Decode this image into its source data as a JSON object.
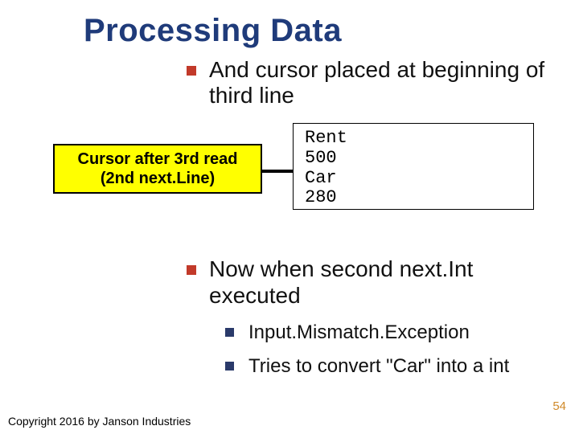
{
  "title": "Processing Data",
  "bullets": [
    {
      "text": "And cursor placed at beginning of third line"
    },
    {
      "text": "Now when second next.Int executed"
    }
  ],
  "diagram": {
    "yellow_box": {
      "line1": "Cursor after 3rd read",
      "line2": "(2nd next.Line)"
    },
    "code_lines": [
      "Rent",
      "500",
      "Car",
      "280"
    ]
  },
  "sub_bullets": [
    {
      "text": "Input.Mismatch.Exception"
    },
    {
      "text": "Tries to convert \"Car\" into a int"
    }
  ],
  "page_number": "54",
  "copyright": "Copyright 2016 by Janson Industries",
  "icons": {
    "bullet_primary": "red-square-bullet",
    "bullet_secondary": "dark-square-bullet",
    "arrow": "right-arrow"
  }
}
